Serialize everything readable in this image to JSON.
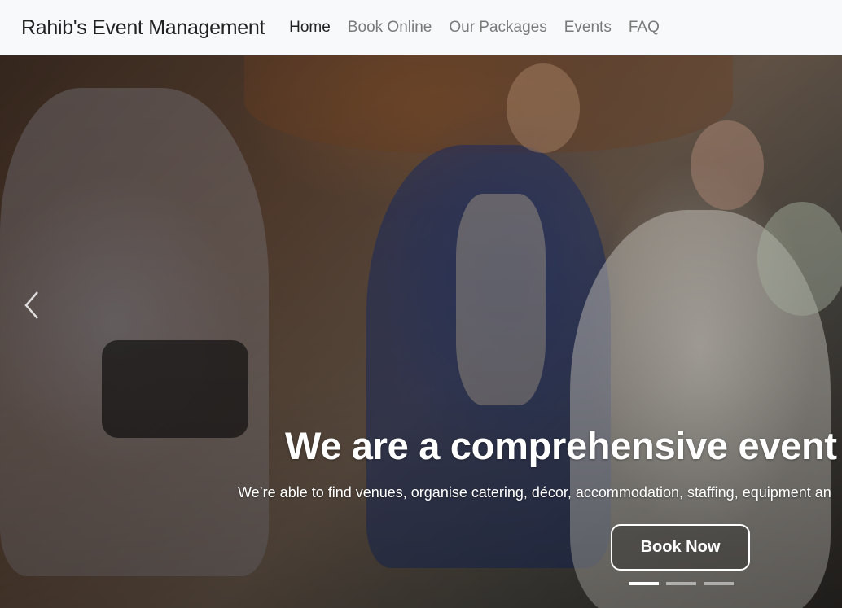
{
  "navbar": {
    "brand": "Rahib's Event Management",
    "links": [
      {
        "label": "Home",
        "active": true
      },
      {
        "label": "Book Online",
        "active": false
      },
      {
        "label": "Our Packages",
        "active": false
      },
      {
        "label": "Events",
        "active": false
      },
      {
        "label": "FAQ",
        "active": false
      }
    ]
  },
  "hero": {
    "title": "We are a comprehensive event pla",
    "subtitle": "We’re able to find venues, organise catering, décor, accommodation, staffing, equipment an",
    "cta_label": "Book Now",
    "prev_icon": "chevron-left-icon",
    "slides_total": 3,
    "active_slide": 1
  }
}
